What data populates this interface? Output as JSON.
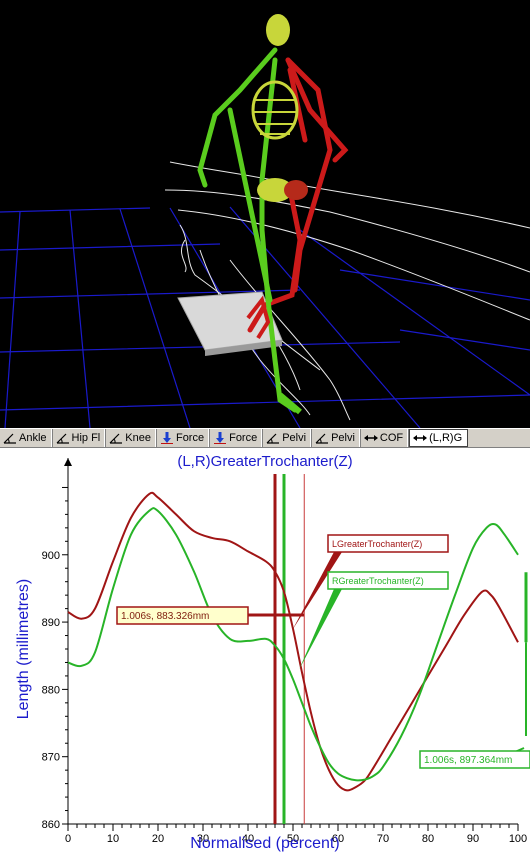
{
  "toolbar": {
    "tabs": [
      {
        "label": "Ankle",
        "icon": "angle-icon"
      },
      {
        "label": "Hip Fl",
        "icon": "angle-icon"
      },
      {
        "label": "Knee",
        "icon": "angle-icon"
      },
      {
        "label": "Force",
        "icon": "force-arrow-icon"
      },
      {
        "label": "Force",
        "icon": "force-arrow-icon"
      },
      {
        "label": "Pelvi",
        "icon": "angle-icon"
      },
      {
        "label": "Pelvi",
        "icon": "angle-icon"
      },
      {
        "label": "COF",
        "icon": "double-arrow-icon"
      },
      {
        "label": "(L,R)G",
        "icon": "double-arrow-icon",
        "active": true
      }
    ]
  },
  "colors": {
    "left_series": "#a01515",
    "right_series": "#28b428",
    "axis_title": "#1c1ccc",
    "grid": "#1a1acc",
    "bone_green": "#5acd1e",
    "bone_yellow": "#c8d63a",
    "bone_red": "#cc1a1a"
  },
  "chart_data": {
    "type": "line",
    "title": "(L,R)GreaterTrochanter(Z)",
    "xlabel": "Normalised (percent)",
    "ylabel": "Length (millimetres)",
    "xlim": [
      0,
      100
    ],
    "ylim": [
      860,
      912
    ],
    "xticks": [
      0,
      10,
      20,
      30,
      40,
      50,
      60,
      70,
      80,
      90,
      100
    ],
    "yticks": [
      860,
      870,
      880,
      890,
      900
    ],
    "series": [
      {
        "name": "LGreaterTrochanter(Z)",
        "color": "#a01515",
        "x": [
          0,
          3,
          6,
          10,
          14,
          18,
          20,
          24,
          28,
          32,
          36,
          40,
          44,
          46,
          48,
          50,
          52,
          54,
          56,
          58,
          60,
          62,
          64,
          66,
          68,
          72,
          76,
          80,
          84,
          88,
          92,
          94,
          96,
          100
        ],
        "y": [
          891.5,
          890.5,
          892,
          899,
          905.5,
          909,
          908.5,
          906,
          903.5,
          902.5,
          902,
          900.5,
          899,
          897.5,
          894.5,
          889,
          882.5,
          876.5,
          871.5,
          868,
          865.8,
          865,
          865.5,
          866.5,
          868.5,
          873,
          877.5,
          882,
          886.5,
          891,
          894.5,
          894,
          892,
          887
        ]
      },
      {
        "name": "RGreaterTrochanter(Z)",
        "color": "#28b428",
        "x": [
          0,
          3,
          6,
          10,
          14,
          18,
          20,
          24,
          28,
          32,
          36,
          40,
          44,
          46,
          48,
          50,
          52,
          54,
          56,
          58,
          60,
          62,
          64,
          66,
          68,
          70,
          74,
          78,
          82,
          86,
          90,
          93,
          95,
          97,
          100
        ],
        "y": [
          884,
          883.5,
          885.5,
          895,
          903,
          906.5,
          906.5,
          903,
          897.5,
          891,
          887.5,
          887.2,
          887.5,
          886.5,
          884.5,
          881.5,
          878,
          874.5,
          871.5,
          869,
          867.5,
          866.8,
          866.5,
          866.6,
          867.2,
          868.5,
          873,
          879,
          886.5,
          894,
          901,
          904,
          904.5,
          903,
          900
        ]
      }
    ],
    "cursors": [
      {
        "x": 46,
        "color": "#a01515"
      },
      {
        "x": 48,
        "color": "#28b428"
      },
      {
        "x": 52.5,
        "color": "#c83c3c"
      }
    ],
    "annotations": [
      {
        "text": "LGreaterTrochanter(Z)",
        "series": "left",
        "target_x": 52.5,
        "target_y": 890
      },
      {
        "text": "RGreaterTrochanter(Z)",
        "series": "right",
        "target_x": 52.5,
        "target_y": 883
      },
      {
        "text": "1.006s, 883.326mm",
        "series": "left",
        "target_x": 52.5,
        "target_y": 883.3,
        "style": "value-box"
      },
      {
        "text": "1.006s, 897.364mm",
        "series": "right",
        "target_x": 100,
        "target_y": 897.4,
        "style": "value-box"
      }
    ],
    "grid": false,
    "legend": "none"
  }
}
